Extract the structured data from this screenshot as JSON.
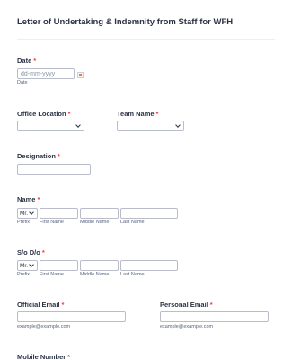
{
  "form": {
    "title": "Letter of Undertaking & Indemnity from Staff for WFH"
  },
  "date": {
    "label": "Date",
    "required_mark": "*",
    "placeholder": "dd-mm-yyyy",
    "sublabel": "Date",
    "icon": "calendar-icon"
  },
  "office_location": {
    "label": "Office Location",
    "required_mark": "*",
    "value": ""
  },
  "team_name": {
    "label": "Team Name",
    "required_mark": "*",
    "value": ""
  },
  "designation": {
    "label": "Designation",
    "required_mark": "*",
    "value": ""
  },
  "name": {
    "label": "Name",
    "required_mark": "*",
    "prefix_value": "Mr.",
    "sublabels": {
      "prefix": "Prefix",
      "first": "First Name",
      "middle": "Middle Name",
      "last": "Last Name"
    }
  },
  "so_do": {
    "label": "S/o D/o",
    "required_mark": "*",
    "prefix_value": "Mr.",
    "sublabels": {
      "prefix": "Prefix",
      "first": "First Name",
      "middle": "Middle Name",
      "last": "Last Name"
    }
  },
  "official_email": {
    "label": "Official Email",
    "required_mark": "*",
    "sublabel": "example@example.com"
  },
  "personal_email": {
    "label": "Personal Email",
    "required_mark": "*",
    "sublabel": "example@example.com"
  },
  "mobile_number": {
    "label": "Mobile Number",
    "required_mark": "*"
  },
  "colors": {
    "text": "#2c3345",
    "required": "#f23a3c",
    "border": "#b8bdc9",
    "sublabel": "#57647e"
  }
}
